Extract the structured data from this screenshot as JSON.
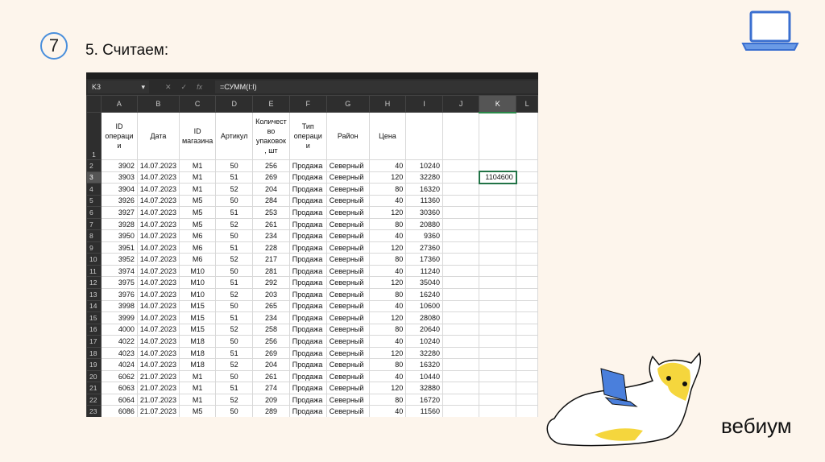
{
  "slide": {
    "number": "7",
    "title": "5. Считаем:",
    "brand": "вебиум"
  },
  "excel": {
    "name_box": "K3",
    "formula": "=СУММ(I:I)",
    "fx_label": "fx",
    "cancel": "✕",
    "confirm": "✓",
    "columns": [
      "A",
      "B",
      "C",
      "D",
      "E",
      "F",
      "G",
      "H",
      "I",
      "J",
      "K",
      "L"
    ],
    "headers": [
      "ID операци и",
      "Дата",
      "ID магазина",
      "Артикул",
      "Количест во упаковок , шт",
      "Тип операци и",
      "Район",
      "Цена",
      "",
      "",
      "",
      ""
    ],
    "rows": [
      [
        "3902",
        "14.07.2023",
        "M1",
        "50",
        "256",
        "Продажа",
        "Северный",
        "40",
        "10240",
        "",
        ""
      ],
      [
        "3903",
        "14.07.2023",
        "M1",
        "51",
        "269",
        "Продажа",
        "Северный",
        "120",
        "32280",
        "",
        "1104600"
      ],
      [
        "3904",
        "14.07.2023",
        "M1",
        "52",
        "204",
        "Продажа",
        "Северный",
        "80",
        "16320",
        "",
        ""
      ],
      [
        "3926",
        "14.07.2023",
        "M5",
        "50",
        "284",
        "Продажа",
        "Северный",
        "40",
        "11360",
        "",
        ""
      ],
      [
        "3927",
        "14.07.2023",
        "M5",
        "51",
        "253",
        "Продажа",
        "Северный",
        "120",
        "30360",
        "",
        ""
      ],
      [
        "3928",
        "14.07.2023",
        "M5",
        "52",
        "261",
        "Продажа",
        "Северный",
        "80",
        "20880",
        "",
        ""
      ],
      [
        "3950",
        "14.07.2023",
        "M6",
        "50",
        "234",
        "Продажа",
        "Северный",
        "40",
        "9360",
        "",
        ""
      ],
      [
        "3951",
        "14.07.2023",
        "M6",
        "51",
        "228",
        "Продажа",
        "Северный",
        "120",
        "27360",
        "",
        ""
      ],
      [
        "3952",
        "14.07.2023",
        "M6",
        "52",
        "217",
        "Продажа",
        "Северный",
        "80",
        "17360",
        "",
        ""
      ],
      [
        "3974",
        "14.07.2023",
        "M10",
        "50",
        "281",
        "Продажа",
        "Северный",
        "40",
        "11240",
        "",
        ""
      ],
      [
        "3975",
        "14.07.2023",
        "M10",
        "51",
        "292",
        "Продажа",
        "Северный",
        "120",
        "35040",
        "",
        ""
      ],
      [
        "3976",
        "14.07.2023",
        "M10",
        "52",
        "203",
        "Продажа",
        "Северный",
        "80",
        "16240",
        "",
        ""
      ],
      [
        "3998",
        "14.07.2023",
        "M15",
        "50",
        "265",
        "Продажа",
        "Северный",
        "40",
        "10600",
        "",
        ""
      ],
      [
        "3999",
        "14.07.2023",
        "M15",
        "51",
        "234",
        "Продажа",
        "Северный",
        "120",
        "28080",
        "",
        ""
      ],
      [
        "4000",
        "14.07.2023",
        "M15",
        "52",
        "258",
        "Продажа",
        "Северный",
        "80",
        "20640",
        "",
        ""
      ],
      [
        "4022",
        "14.07.2023",
        "M18",
        "50",
        "256",
        "Продажа",
        "Северный",
        "40",
        "10240",
        "",
        ""
      ],
      [
        "4023",
        "14.07.2023",
        "M18",
        "51",
        "269",
        "Продажа",
        "Северный",
        "120",
        "32280",
        "",
        ""
      ],
      [
        "4024",
        "14.07.2023",
        "M18",
        "52",
        "204",
        "Продажа",
        "Северный",
        "80",
        "16320",
        "",
        ""
      ],
      [
        "6062",
        "21.07.2023",
        "M1",
        "50",
        "261",
        "Продажа",
        "Северный",
        "40",
        "10440",
        "",
        ""
      ],
      [
        "6063",
        "21.07.2023",
        "M1",
        "51",
        "274",
        "Продажа",
        "Северный",
        "120",
        "32880",
        "",
        ""
      ],
      [
        "6064",
        "21.07.2023",
        "M1",
        "52",
        "209",
        "Продажа",
        "Северный",
        "80",
        "16720",
        "",
        ""
      ],
      [
        "6086",
        "21.07.2023",
        "M5",
        "50",
        "289",
        "Продажа",
        "Северный",
        "40",
        "11560",
        "",
        ""
      ]
    ]
  }
}
